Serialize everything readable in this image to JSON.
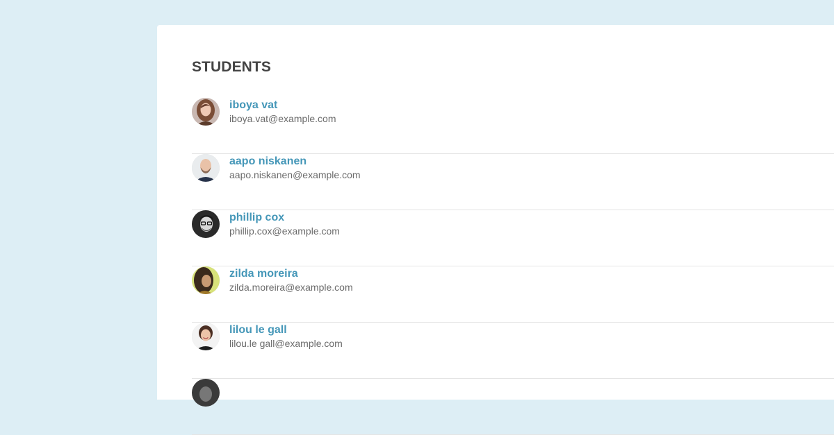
{
  "page": {
    "heading": "STUDENTS"
  },
  "students": [
    {
      "name": "iboya vat",
      "email": "iboya.vat@example.com",
      "avatar": "avatar-woman-brown-hair"
    },
    {
      "name": "aapo niskanen",
      "email": "aapo.niskanen@example.com",
      "avatar": "avatar-man-bald-beard"
    },
    {
      "name": "phillip cox",
      "email": "phillip.cox@example.com",
      "avatar": "avatar-man-glasses"
    },
    {
      "name": "zilda moreira",
      "email": "zilda.moreira@example.com",
      "avatar": "avatar-woman-dark-hair"
    },
    {
      "name": "lilou le gall",
      "email": "lilou.le gall@example.com",
      "avatar": "avatar-woman-smiling"
    }
  ],
  "colors": {
    "background": "#ddeef5",
    "panel": "#ffffff",
    "heading": "#444444",
    "name_link": "#4597b8",
    "email_text": "#6b6b6b",
    "divider": "#e4e4e4"
  }
}
